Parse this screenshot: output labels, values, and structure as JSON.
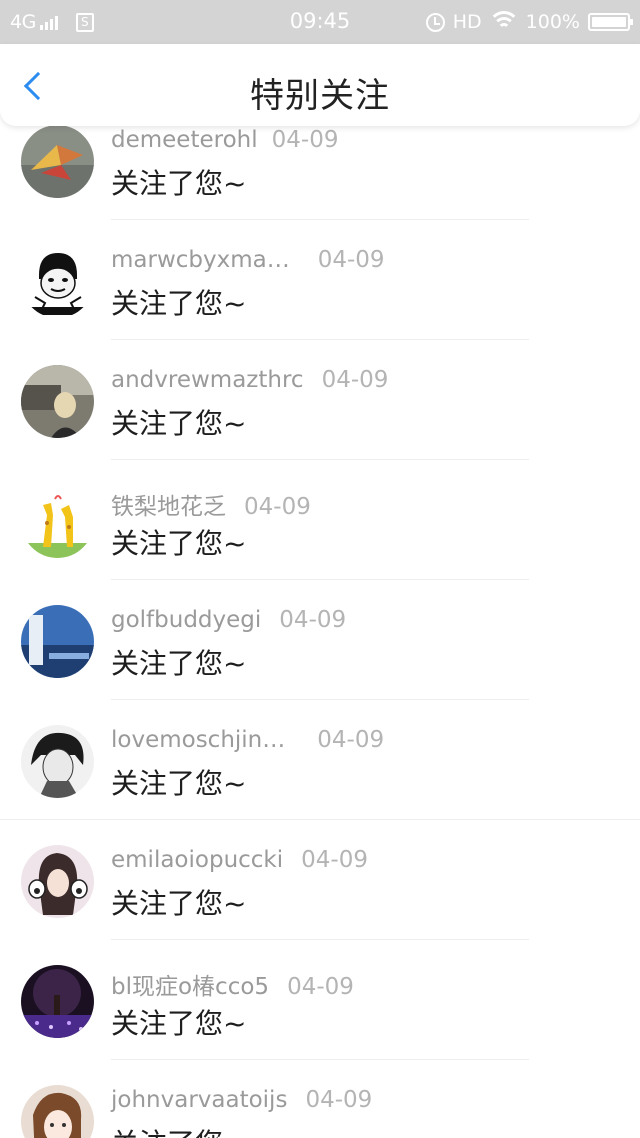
{
  "status_bar": {
    "network": "4G",
    "time": "09:45",
    "hd": "HD",
    "battery_percent": "100%",
    "sim_label": "S"
  },
  "nav": {
    "title": "特别关注",
    "back_icon": "chevron-left-icon",
    "accent_color": "#2d8cf0"
  },
  "items": [
    {
      "username": "demeeterohl",
      "date": "04-09",
      "message": "关注了您~"
    },
    {
      "username": "marwcbyxma…",
      "date": "04-09",
      "message": "关注了您~"
    },
    {
      "username": "andvrewmazthrc",
      "date": "04-09",
      "message": "关注了您~"
    },
    {
      "username": "铁梨地花乏",
      "date": "04-09",
      "message": "关注了您~"
    },
    {
      "username": "golfbuddyegi",
      "date": "04-09",
      "message": "关注了您~"
    },
    {
      "username": "lovemoschjin…",
      "date": "04-09",
      "message": "关注了您~"
    },
    {
      "username": "emilaoiopuccki",
      "date": "04-09",
      "message": "关注了您~"
    },
    {
      "username": "bl现症o椿cco5",
      "date": "04-09",
      "message": "关注了您~"
    },
    {
      "username": "johnvarvaatoijs",
      "date": "04-09",
      "message": "关注了您~"
    }
  ]
}
